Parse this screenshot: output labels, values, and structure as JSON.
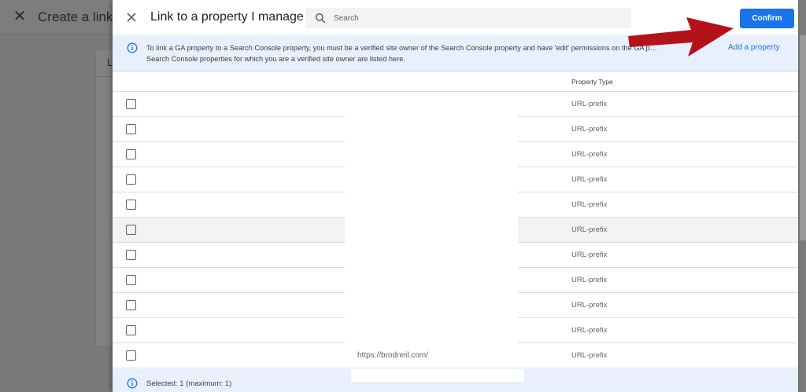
{
  "background": {
    "title": "Create a link w",
    "card_letter": "L"
  },
  "panel": {
    "title": "Link to a property I manage",
    "search_placeholder": "Search",
    "confirm_label": "Confirm",
    "info_text": "To link a GA property to a Search Console property, you must be a verified site owner of the Search Console property and have 'edit' permissions on the GA p… Search Console properties for which you are a verified site owner are listed here.",
    "add_property_label": "Add a property",
    "column_header": "Property Type",
    "rows": [
      {
        "url": "",
        "type": "URL-prefix"
      },
      {
        "url": "",
        "type": "URL-prefix"
      },
      {
        "url": "",
        "type": "URL-prefix"
      },
      {
        "url": "",
        "type": "URL-prefix"
      },
      {
        "url": "",
        "type": "URL-prefix"
      },
      {
        "url": "",
        "type": "URL-prefix"
      },
      {
        "url": "",
        "type": "URL-prefix"
      },
      {
        "url": "",
        "type": "URL-prefix"
      },
      {
        "url": "",
        "type": "URL-prefix"
      },
      {
        "url": "",
        "type": "URL-prefix"
      },
      {
        "url": "https://brodneil.com/",
        "type": "URL-prefix"
      }
    ],
    "footer_text": "Selected: 1 (maximum: 1)"
  },
  "colors": {
    "accent": "#1a73e8",
    "banner": "#e8f0fe",
    "annotation_arrow": "#b3121b"
  },
  "icons": [
    "close-icon",
    "search-icon",
    "info-icon"
  ]
}
